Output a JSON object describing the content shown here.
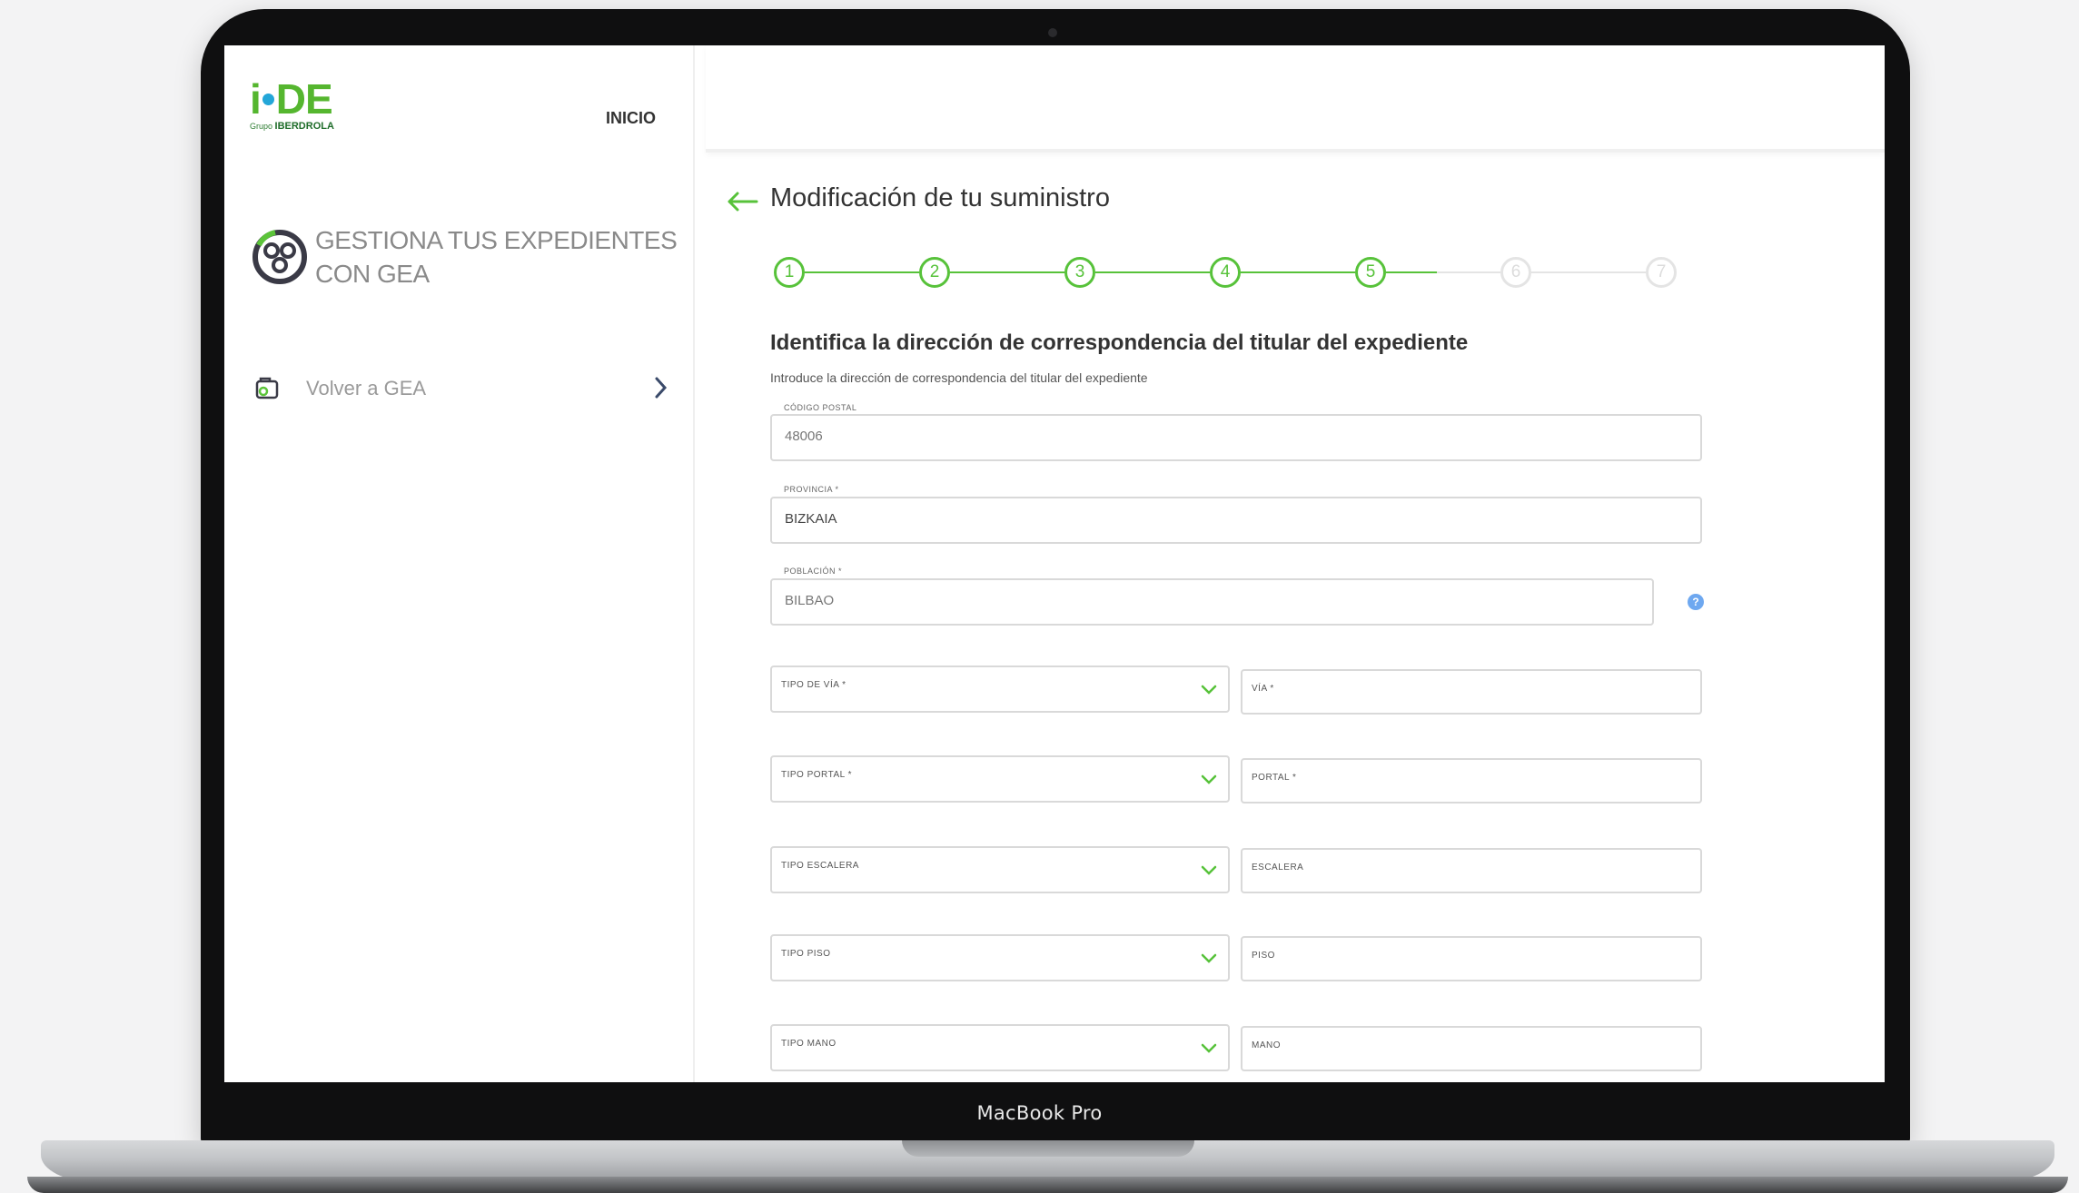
{
  "device": {
    "label": "MacBook Pro"
  },
  "sidebar": {
    "logo": {
      "text": "i-DE",
      "subtitle_prefix": "Grupo",
      "subtitle_brand": "IBERDROLA"
    },
    "nav_inicio": "INICIO",
    "gea_title_line1": "GESTIONA TUS EXPEDIENTES",
    "gea_title_line2": "CON GEA",
    "volver_label": "Volver a GEA"
  },
  "main": {
    "page_title": "Modificación de tu suministro",
    "stepper": {
      "steps": [
        "1",
        "2",
        "3",
        "4",
        "5",
        "6",
        "7"
      ],
      "current_step": 5
    },
    "section_title": "Identifica la dirección de correspondencia del titular del expediente",
    "section_subtitle": "Introduce la dirección de correspondencia del titular del expediente",
    "fields": {
      "codigo_postal": {
        "label": "CÓDIGO POSTAL",
        "value": "48006"
      },
      "provincia": {
        "label": "PROVINCIA *",
        "value": "BIZKAIA"
      },
      "poblacion": {
        "label": "POBLACIÓN *",
        "value": "BILBAO"
      },
      "tipo_via": {
        "label": "TIPO DE VÍA *"
      },
      "via": {
        "label": "VÍA *"
      },
      "tipo_portal": {
        "label": "TIPO PORTAL *"
      },
      "portal": {
        "label": "PORTAL *"
      },
      "tipo_escalera": {
        "label": "TIPO ESCALERA"
      },
      "escalera": {
        "label": "ESCALERA"
      },
      "tipo_piso": {
        "label": "TIPO PISO"
      },
      "piso": {
        "label": "PISO"
      },
      "tipo_mano": {
        "label": "TIPO MANO"
      },
      "mano": {
        "label": "MANO"
      }
    }
  },
  "colors": {
    "brand_green": "#57c23a",
    "brand_blue": "#23a6d8",
    "help_blue": "#6ea8f0"
  }
}
